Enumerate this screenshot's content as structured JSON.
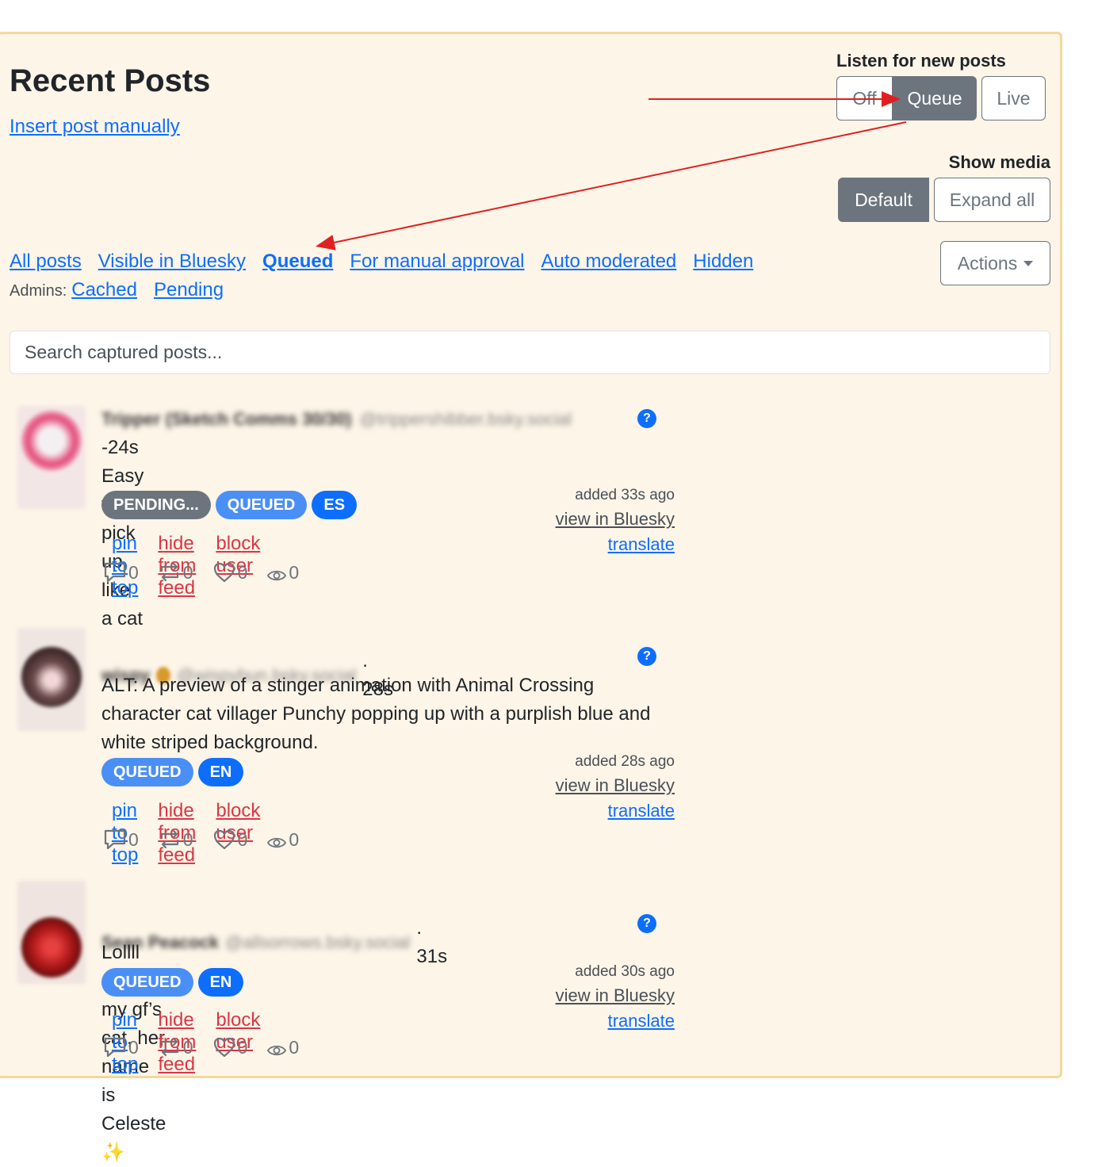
{
  "page": {
    "title": "Recent Posts",
    "insert_link": "Insert post manually"
  },
  "listen": {
    "label": "Listen for new posts",
    "options": [
      "Off",
      "Queue",
      "Live"
    ],
    "selected": "Queue"
  },
  "media": {
    "label": "Show media",
    "options": [
      "Default",
      "Expand all"
    ],
    "selected": "Default"
  },
  "actions_label": "Actions",
  "filters": [
    "All posts",
    "Visible in Bluesky",
    "Queued",
    "For manual approval",
    "Auto moderated",
    "Hidden"
  ],
  "active_filter": "Queued",
  "admins": {
    "label": "Admins:",
    "links": [
      "Cached",
      "Pending"
    ]
  },
  "search": {
    "placeholder": "Search captured posts..."
  },
  "posts": [
    {
      "author": "Tripper (Sketch Comms 30/30)",
      "handle": "@trippershibber.bsky.social",
      "time": "-24s",
      "text": "Easy to pick up like a cat",
      "badges": [
        "PENDING...",
        "QUEUED",
        "ES"
      ],
      "added": "added 33s ago",
      "view_link": "view in Bluesky",
      "translate_link": "translate",
      "actions": [
        "pin to top",
        "hide from feed",
        "block user"
      ],
      "stats": {
        "replies": "0",
        "reposts": "0",
        "likes": "0",
        "views": "0"
      },
      "help": "?"
    },
    {
      "author": "wispy",
      "handle": "@wispybun.bsky.social",
      "time": ". 28s",
      "text": "ALT: A preview of a stinger animation with Animal Crossing character cat villager Punchy popping up with a purplish blue and white striped background.",
      "badges": [
        "QUEUED",
        "EN"
      ],
      "added": "added 28s ago",
      "view_link": "view in Bluesky",
      "translate_link": "translate",
      "actions": [
        "pin to top",
        "hide from feed",
        "block user"
      ],
      "stats": {
        "replies": "0",
        "reposts": "0",
        "likes": "0",
        "views": "0"
      },
      "help": "?"
    },
    {
      "author": "Sean Peacock",
      "handle": "@allsorrows.bsky.social",
      "time": ". 31s",
      "text": "Lollll she’s my gf’s cat, her name is Celeste ✨",
      "badges": [
        "QUEUED",
        "EN"
      ],
      "added": "added 30s ago",
      "view_link": "view in Bluesky",
      "translate_link": "translate",
      "actions": [
        "pin to top",
        "hide from feed",
        "block user"
      ],
      "stats": {
        "replies": "0",
        "reposts": "0",
        "likes": "0",
        "views": "0"
      },
      "help": "?"
    }
  ],
  "colors": {
    "panel_bg": "#fdf5e8",
    "panel_border": "#f6d79a",
    "link": "#0d6efd",
    "danger_link": "#dc3545",
    "annotation_arrow": "#e02020"
  }
}
